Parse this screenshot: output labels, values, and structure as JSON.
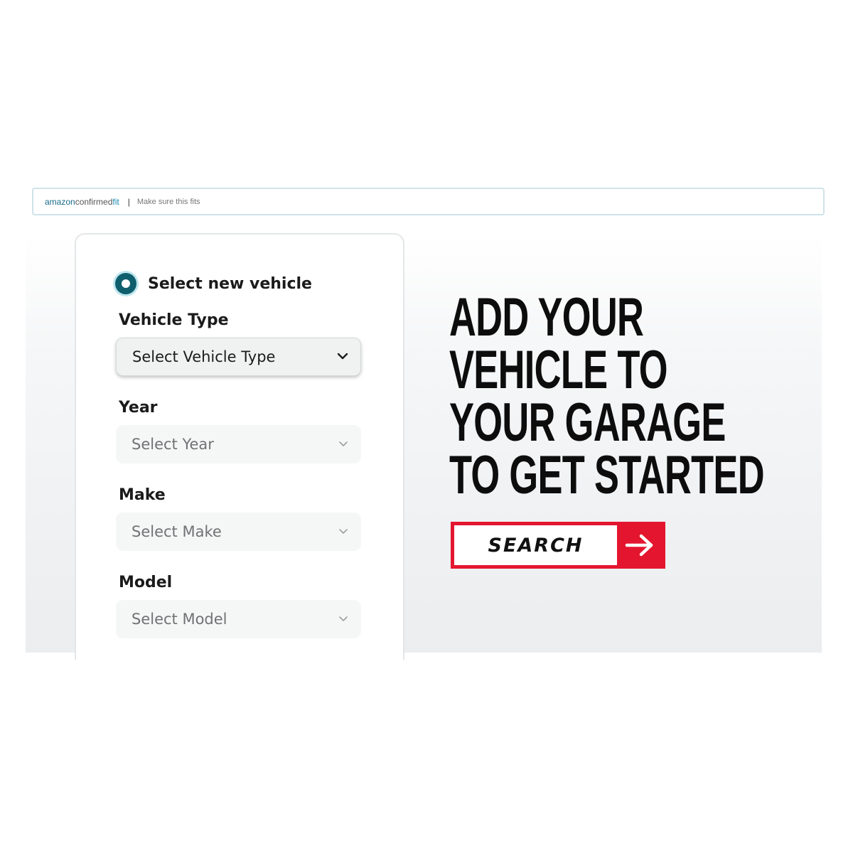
{
  "top_bar": {
    "brand_amazon": "amazon",
    "brand_confirmed": "confirmed",
    "brand_fit": "fit",
    "separator": "|",
    "note": "Make sure this fits"
  },
  "form": {
    "radio_label": "Select new vehicle",
    "radio_selected": true,
    "fields": [
      {
        "label": "Vehicle Type",
        "value": "Select Vehicle Type",
        "enabled": true
      },
      {
        "label": "Year",
        "value": "Select Year",
        "enabled": false
      },
      {
        "label": "Make",
        "value": "Select Make",
        "enabled": false
      },
      {
        "label": "Model",
        "value": "Select Model",
        "enabled": false
      }
    ]
  },
  "headline": {
    "line1": "ADD YOUR",
    "line2": "VEHICLE TO",
    "line3": "YOUR GARAGE",
    "line4": "TO GET STARTED"
  },
  "search_button": {
    "label": "SEARCH",
    "icon": "arrow-right-icon"
  },
  "colors": {
    "accent_red": "#e4162f",
    "radio_teal": "#0f5e6e",
    "brand_blue": "#1a8ab0"
  }
}
